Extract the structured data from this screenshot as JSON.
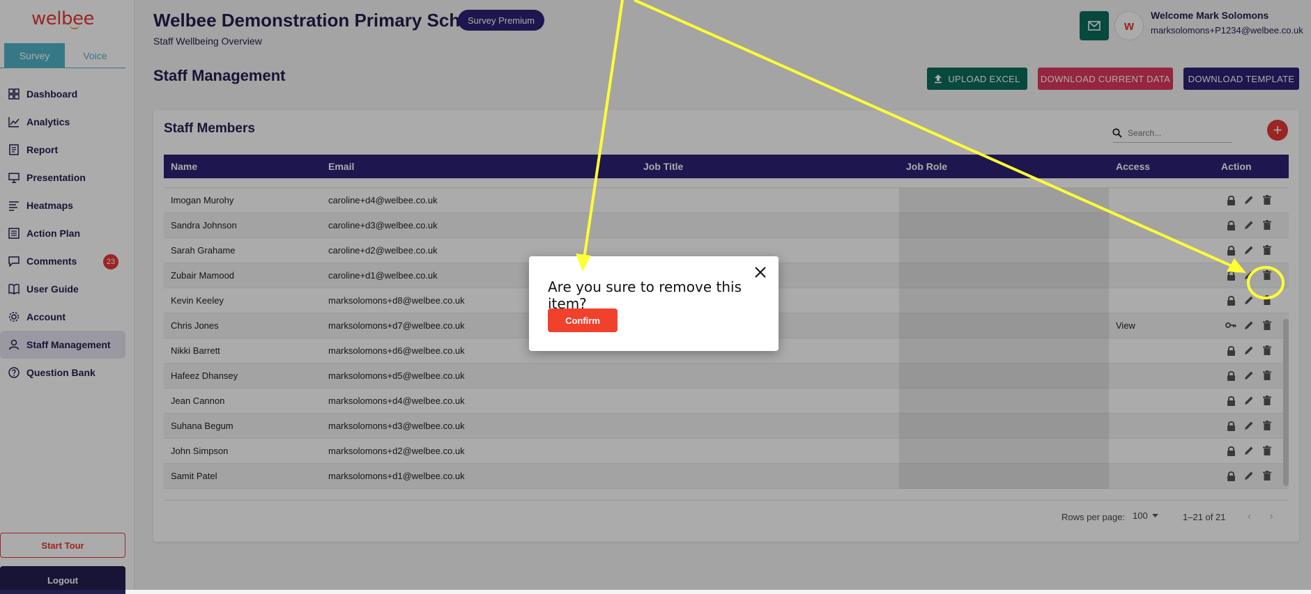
{
  "sidebar": {
    "logo": "welbee",
    "switch": {
      "survey": "Survey",
      "voice": "Voice"
    },
    "items": [
      {
        "label": "Dashboard",
        "icon": "dashboard-icon"
      },
      {
        "label": "Analytics",
        "icon": "analytics-icon"
      },
      {
        "label": "Report",
        "icon": "report-icon"
      },
      {
        "label": "Presentation",
        "icon": "presentation-icon"
      },
      {
        "label": "Heatmaps",
        "icon": "heatmaps-icon"
      },
      {
        "label": "Action Plan",
        "icon": "action-plan-icon"
      },
      {
        "label": "Comments",
        "icon": "comments-icon",
        "badge": "23"
      },
      {
        "label": "User Guide",
        "icon": "book-icon"
      },
      {
        "label": "Account",
        "icon": "gear-icon"
      },
      {
        "label": "Staff Management",
        "icon": "user-icon"
      },
      {
        "label": "Question Bank",
        "icon": "question-icon"
      }
    ],
    "start_tour": "Start Tour",
    "logout": "Logout"
  },
  "header": {
    "school": "Welbee Demonstration Primary School",
    "badge": "Survey Premium",
    "subtitle": "Staff Wellbeing Overview",
    "welcome": "Welcome Mark Solomons",
    "email": "marksolomons+P1234@welbee.co.uk",
    "avatar_letter": "w"
  },
  "page": {
    "title": "Staff Management",
    "upload": "UPLOAD EXCEL",
    "download_current": "DOWNLOAD CURRENT DATA",
    "download_template": "DOWNLOAD TEMPLATE"
  },
  "table": {
    "title": "Staff Members",
    "search_placeholder": "Search...",
    "columns": [
      "Name",
      "Email",
      "Job Title",
      "Job Role",
      "Access",
      "Action"
    ],
    "rows": [
      {
        "name": "Imogan Murohy",
        "email": "caroline+d4@welbee.co.uk",
        "access": "",
        "lock": "lock"
      },
      {
        "name": "Sandra Johnson",
        "email": "caroline+d3@welbee.co.uk",
        "access": "",
        "lock": "lock"
      },
      {
        "name": "Sarah Grahame",
        "email": "caroline+d2@welbee.co.uk",
        "access": "",
        "lock": "lock"
      },
      {
        "name": "Zubair Mamood",
        "email": "caroline+d1@welbee.co.uk",
        "access": "",
        "lock": "lock"
      },
      {
        "name": "Kevin Keeley",
        "email": "marksolomons+d8@welbee.co.uk",
        "access": "",
        "lock": "lock"
      },
      {
        "name": "Chris Jones",
        "email": "marksolomons+d7@welbee.co.uk",
        "access": "View",
        "lock": "key"
      },
      {
        "name": "Nikki Barrett",
        "email": "marksolomons+d6@welbee.co.uk",
        "access": "",
        "lock": "lock"
      },
      {
        "name": "Hafeez Dhansey",
        "email": "marksolomons+d5@welbee.co.uk",
        "access": "",
        "lock": "lock"
      },
      {
        "name": "Jean Cannon",
        "email": "marksolomons+d4@welbee.co.uk",
        "access": "",
        "lock": "lock"
      },
      {
        "name": "Suhana Begum",
        "email": "marksolomons+d3@welbee.co.uk",
        "access": "",
        "lock": "lock"
      },
      {
        "name": "John Simpson",
        "email": "marksolomons+d2@welbee.co.uk",
        "access": "",
        "lock": "lock"
      },
      {
        "name": "Samit Patel",
        "email": "marksolomons+d1@welbee.co.uk",
        "access": "",
        "lock": "lock"
      }
    ],
    "rows_per_page_label": "Rows per page:",
    "rows_per_page": "100",
    "range": "1–21 of 21"
  },
  "modal": {
    "question": "Are you sure to remove this item?",
    "confirm": "Confirm"
  },
  "colors": {
    "brand_red": "#e53935",
    "navy": "#2d2275",
    "teal": "#0d6d5d",
    "pink": "#e0385f",
    "annotation": "#ffff33"
  }
}
